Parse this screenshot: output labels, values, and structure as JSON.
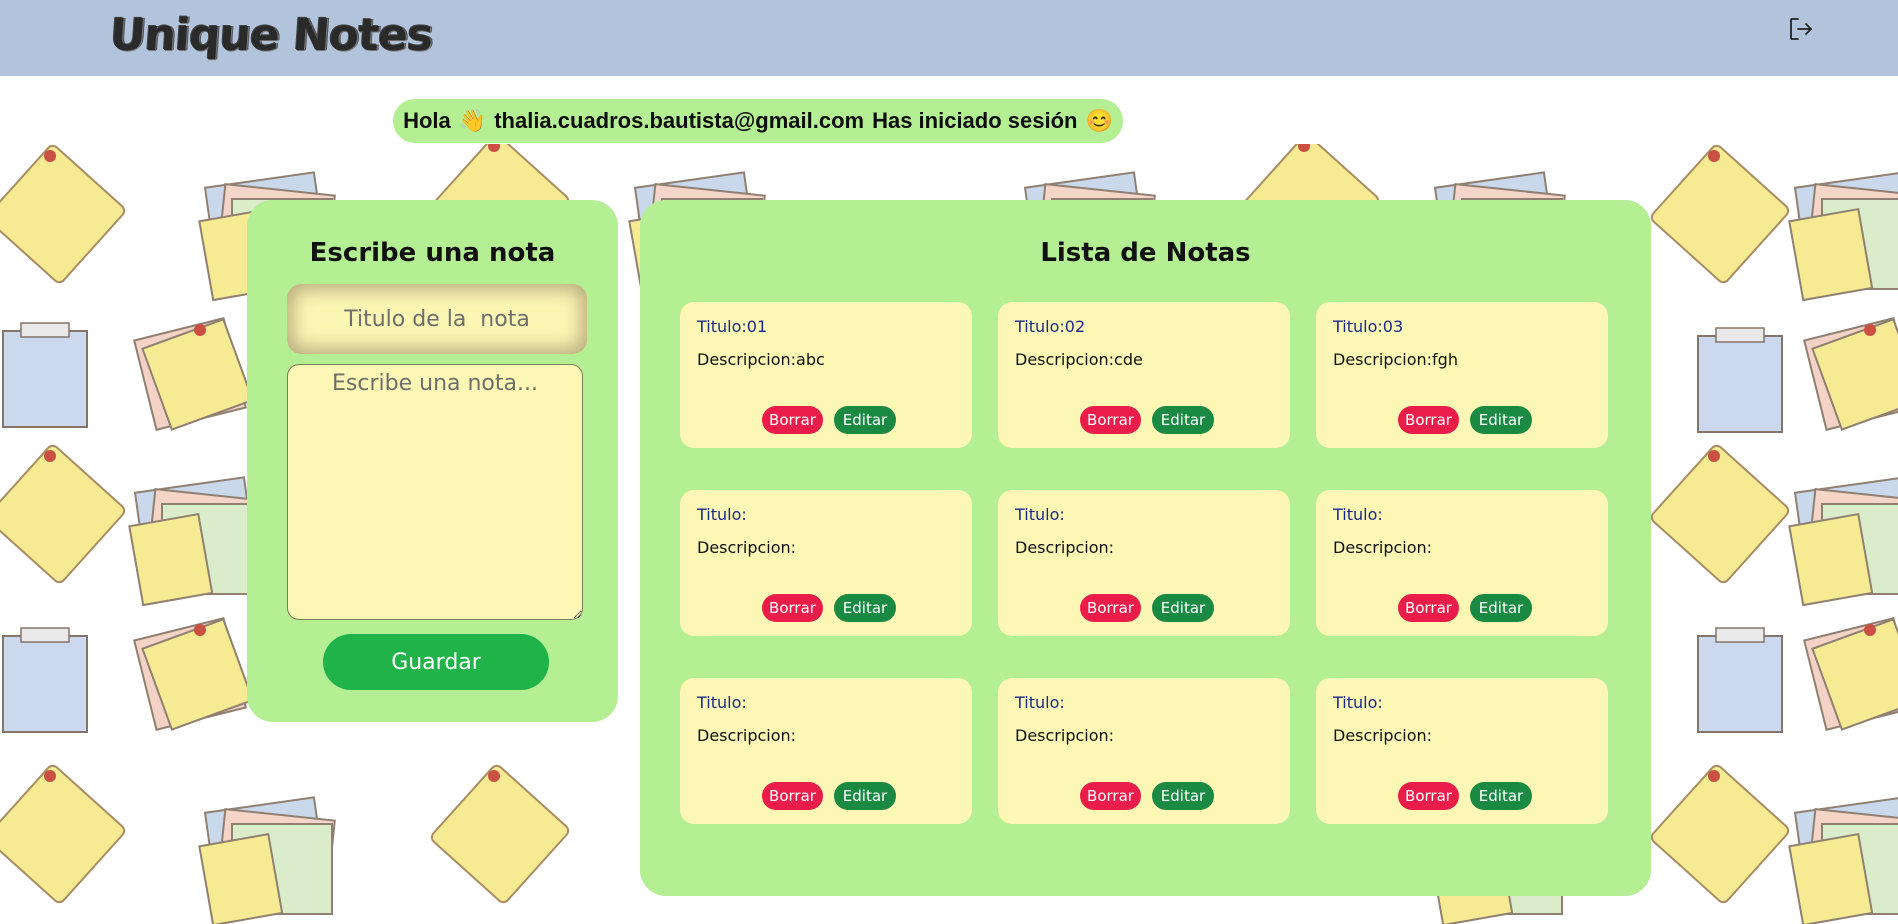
{
  "header": {
    "logo": "Unique Notes",
    "logout_icon": "logout-icon"
  },
  "greeting": {
    "hello": "Hola",
    "wave_emoji": "👋",
    "email": "thalia.cuadros.bautista@gmail.com",
    "status": "Has iniciado sesión",
    "smile_emoji": "😊"
  },
  "form": {
    "title": "Escribe una nota",
    "title_placeholder": "Titulo de la  nota",
    "body_placeholder": "Escribe una nota...",
    "save_label": "Guardar"
  },
  "list": {
    "title": "Lista de Notas",
    "notes": [
      {
        "title": "Titulo:01",
        "desc": "Descripcion:abc",
        "delete": "Borrar",
        "edit": "Editar"
      },
      {
        "title": "Titulo:02",
        "desc": "Descripcion:cde",
        "delete": "Borrar",
        "edit": "Editar"
      },
      {
        "title": "Titulo:03",
        "desc": "Descripcion:fgh",
        "delete": "Borrar",
        "edit": "Editar"
      },
      {
        "title": "Titulo:",
        "desc": "Descripcion:",
        "delete": "Borrar",
        "edit": "Editar"
      },
      {
        "title": "Titulo:",
        "desc": "Descripcion:",
        "delete": "Borrar",
        "edit": "Editar"
      },
      {
        "title": "Titulo:",
        "desc": "Descripcion:",
        "delete": "Borrar",
        "edit": "Editar"
      },
      {
        "title": "Titulo:",
        "desc": "Descripcion:",
        "delete": "Borrar",
        "edit": "Editar"
      },
      {
        "title": "Titulo:",
        "desc": "Descripcion:",
        "delete": "Borrar",
        "edit": "Editar"
      },
      {
        "title": "Titulo:",
        "desc": "Descripcion:",
        "delete": "Borrar",
        "edit": "Editar"
      }
    ]
  },
  "colors": {
    "header": "#b2c3dc",
    "panel": "#b4ef93",
    "card": "#fcf7b4",
    "save": "#20b34a",
    "delete": "#ea1d4a",
    "edit": "#1a8a43"
  }
}
